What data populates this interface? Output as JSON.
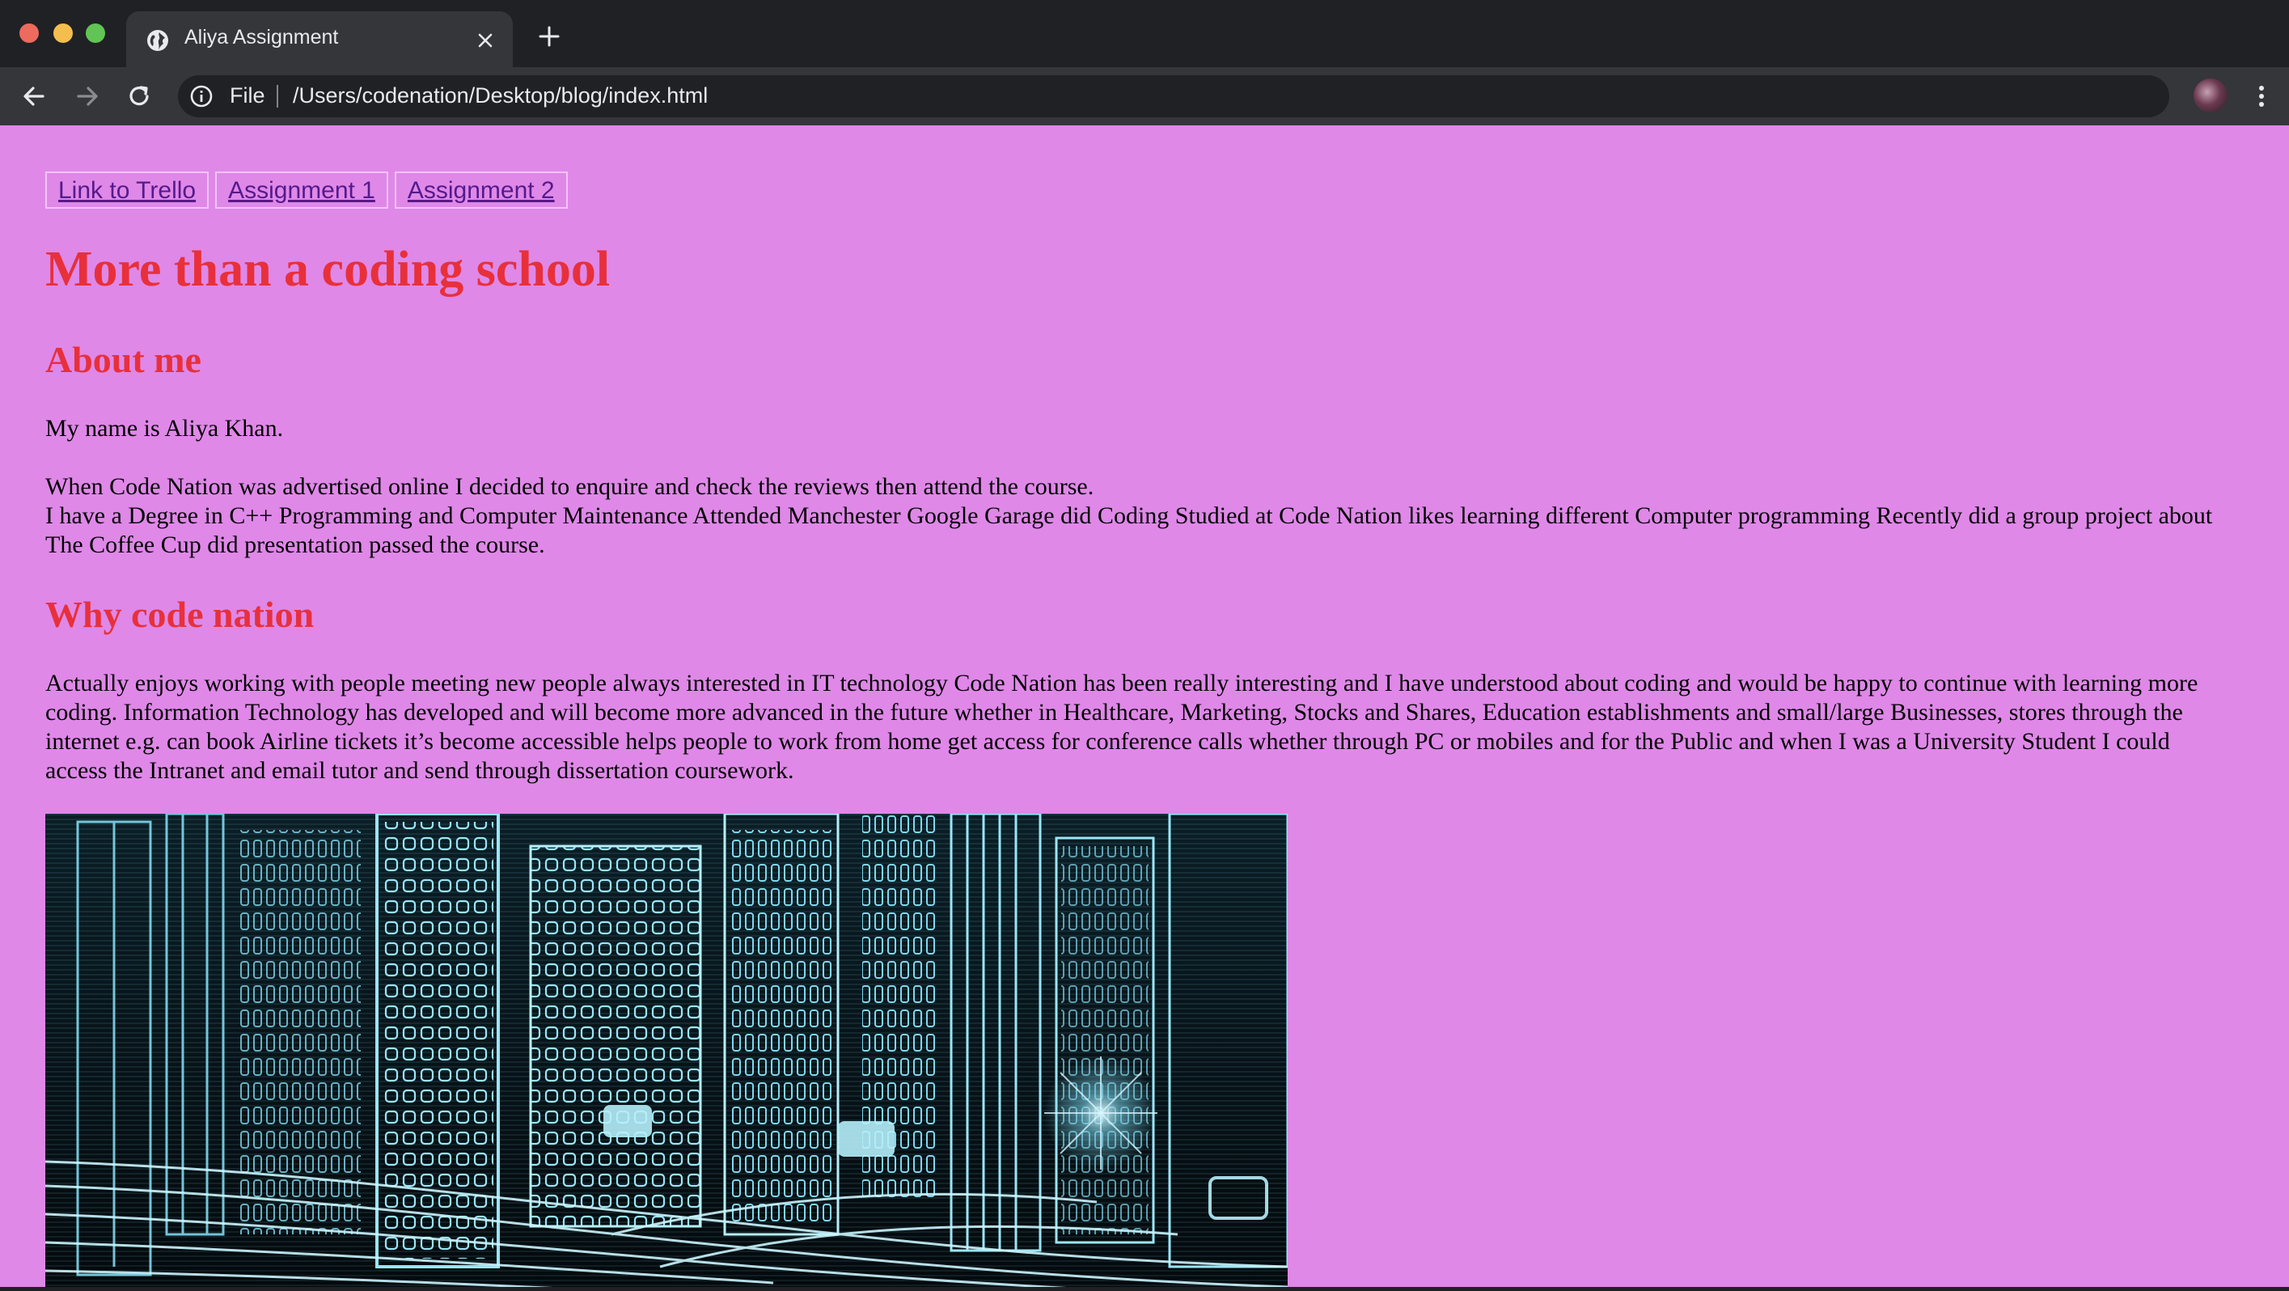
{
  "browser": {
    "tab": {
      "title": "Aliya Assignment"
    },
    "address_bar": {
      "scheme_label": "File",
      "url": "/Users/codenation/Desktop/blog/index.html"
    },
    "icons": {
      "favicon": "globe-icon",
      "close": "close-icon",
      "new_tab": "plus-icon",
      "back": "arrow-left-icon",
      "forward": "arrow-right-icon",
      "reload": "reload-icon",
      "info": "info-icon",
      "bookmark": "star-icon",
      "menu": "kebab-menu-icon"
    }
  },
  "page": {
    "background": "#df88e8",
    "heading_color": "#e8303a",
    "link_color": "#551a8b",
    "nav_links": [
      {
        "label": "Link to Trello"
      },
      {
        "label": "Assignment 1"
      },
      {
        "label": "Assignment 2"
      }
    ],
    "title": "More than a coding school",
    "about": {
      "heading": "About me",
      "name_line": "My name is Aliya Khan.",
      "para_line1": "When Code Nation was advertised online I decided to enquire and check the reviews then attend the course.",
      "para_line2": "I have a Degree in C++ Programming and Computer Maintenance Attended Manchester Google Garage did Coding Studied at Code Nation likes learning different Computer programming Recently did a group project about The Coffee Cup did presentation passed the course."
    },
    "why": {
      "heading": "Why code nation",
      "paragraph": "Actually enjoys working with people meeting new people always interested in IT technology Code Nation has been really interesting and I have understood about coding and would be happy to continue with learning more coding. Information Technology has developed and will become more advanced in the future whether in Healthcare, Marketing, Stocks and Shares, Education establishments and small/large Businesses, stores through the internet e.g. can book Airline tickets it’s become accessible helps people to work from home get access for conference calls whether through PC or mobiles and for the Public and when I was a University Student I could access the Intranet and email tutor and send through dissertation coursework."
    }
  }
}
